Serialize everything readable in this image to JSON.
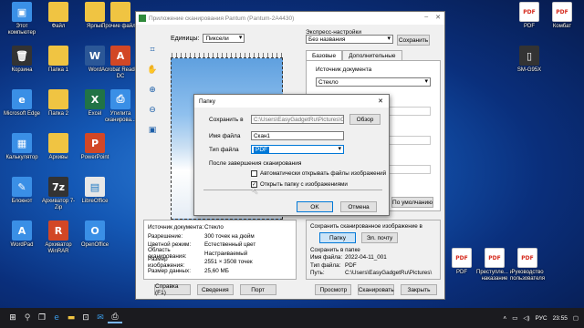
{
  "desktop_icons_left": [
    {
      "label": "Этот компьютер",
      "icon": "computer-icon",
      "glyph": "▣",
      "style": "blue"
    },
    {
      "label": "Файл",
      "icon": "folder-icon",
      "glyph": "",
      "style": "folder"
    },
    {
      "label": "Ярлык",
      "icon": "folder-icon",
      "glyph": "",
      "style": "folder"
    },
    {
      "label": "Корзина",
      "icon": "recycle-bin-icon",
      "glyph": "🗑",
      "style": "dark"
    },
    {
      "label": "Папка 1",
      "icon": "folder-icon",
      "glyph": "",
      "style": "folder"
    },
    {
      "label": "Word",
      "icon": "word-icon",
      "glyph": "W",
      "style": "word"
    },
    {
      "label": "Microsoft Edge",
      "icon": "edge-icon",
      "glyph": "e",
      "style": "blue"
    },
    {
      "label": "Папка 2",
      "icon": "folder-icon",
      "glyph": "",
      "style": "folder"
    },
    {
      "label": "Excel",
      "icon": "excel-icon",
      "glyph": "X",
      "style": "excel"
    },
    {
      "label": "Калькулятор",
      "icon": "calculator-icon",
      "glyph": "▦",
      "style": "blue"
    },
    {
      "label": "Архивы",
      "icon": "folder-icon",
      "glyph": "",
      "style": "folder"
    },
    {
      "label": "PowerPoint",
      "icon": "powerpoint-icon",
      "glyph": "P",
      "style": "ppt"
    },
    {
      "label": "Блокнот",
      "icon": "notepad-icon",
      "glyph": "✎",
      "style": "blue"
    },
    {
      "label": "Архиватор 7-Zip",
      "icon": "7zip-icon",
      "glyph": "7z",
      "style": "dark"
    },
    {
      "label": "LibreOffice",
      "icon": "libreoffice-icon",
      "glyph": "▤",
      "style": "lo"
    },
    {
      "label": "WordPad",
      "icon": "wordpad-icon",
      "glyph": "A",
      "style": "blue"
    },
    {
      "label": "Архиватор WinRAR",
      "icon": "winrar-icon",
      "glyph": "R",
      "style": "ppt"
    },
    {
      "label": "OpenOffice",
      "icon": "openoffice-icon",
      "glyph": "O",
      "style": "blue"
    },
    {
      "label": "Прочие файлы",
      "icon": "folder-icon",
      "glyph": "",
      "style": "folder"
    },
    {
      "label": "Acrobat Reader DC",
      "icon": "acrobat-icon",
      "glyph": "A",
      "style": "ppt"
    },
    {
      "label": "Утилита сканирова...",
      "icon": "scanner-icon",
      "glyph": "⎙",
      "style": "blue"
    }
  ],
  "desktop_icons_right": [
    {
      "label": "PDF",
      "icon": "pdf-file-icon",
      "glyph": "PDF",
      "style": "pdf"
    },
    {
      "label": "SM-G95X",
      "icon": "phone-icon",
      "glyph": "▯",
      "style": "dark"
    },
    {
      "label": "PDF",
      "icon": "pdf-file-icon",
      "glyph": "PDF",
      "style": "pdf"
    },
    {
      "label": "Преступле... и наказание",
      "icon": "pdf-file-icon",
      "glyph": "PDF",
      "style": "pdf"
    },
    {
      "label": "Руководство пользователя",
      "icon": "pdf-file-icon",
      "glyph": "PDF",
      "style": "pdf"
    },
    {
      "label": "Комбат",
      "icon": "pdf-file-icon",
      "glyph": "PDF",
      "style": "pdf"
    }
  ],
  "scan_window": {
    "title": "Приложение сканирования Pantum (Pantum-2A4430)",
    "units_label": "Единицы:",
    "units_value": "Пиксели",
    "express_label": "Экспресс-настройки",
    "express_value": "Без названия",
    "save_preset": "Сохранить",
    "tabs": [
      "Базовые",
      "Дополнительные"
    ],
    "source_label": "Источник документа",
    "source_value": "Стекло",
    "defaults_button": "По умолчанию",
    "info": [
      {
        "k": "Источник документа:",
        "v": "Стекло"
      },
      {
        "k": "Разрешение:",
        "v": "300 точек на дюйм"
      },
      {
        "k": "Цветной режим:",
        "v": "Естественный цвет"
      },
      {
        "k": "Область сканирования:",
        "v": "Настраиваемый"
      },
      {
        "k": "Размер изображения:",
        "v": "2551 × 3508 точек"
      },
      {
        "k": "Размер данных:",
        "v": "25,60 МБ"
      }
    ],
    "save_group": {
      "title": "Сохранить сканированное изображение в",
      "folder_button": "Папку",
      "email_button": "Эл. почту",
      "save_to_folder_label": "Сохранить в папке",
      "rows": [
        {
          "k": "Имя файла:",
          "v": "2022-04-11_001"
        },
        {
          "k": "Тип файла:",
          "v": "PDF"
        },
        {
          "k": "Путь:",
          "v": "C:\\Users\\EasyGadgetRu\\Pictures\\"
        }
      ]
    },
    "bottom_buttons": [
      "Справка (F1)",
      "Сведения",
      "Порт",
      "Просмотр",
      "Сканировать",
      "Закрыть"
    ]
  },
  "folder_dialog": {
    "title": "Папку",
    "save_in_label": "Сохранить в",
    "save_in_value": "C:\\Users\\EasyGadgetRu\\Pictures\\Скан",
    "browse_button": "Обзор",
    "file_name_label": "Имя файла",
    "file_name_value": "Скан1",
    "file_type_label": "Тип файла",
    "file_type_value": "PDF",
    "after_scan_label": "После завершения сканирования",
    "auto_open_label": "Автоматически открывать файлы изображений",
    "auto_open_checked": false,
    "open_folder_label": "Открыть папку с изображениями",
    "open_folder_checked": true,
    "ok_button": "OK",
    "cancel_button": "Отмена"
  },
  "taskbar": {
    "lang": "РУС",
    "time": "23:55"
  }
}
